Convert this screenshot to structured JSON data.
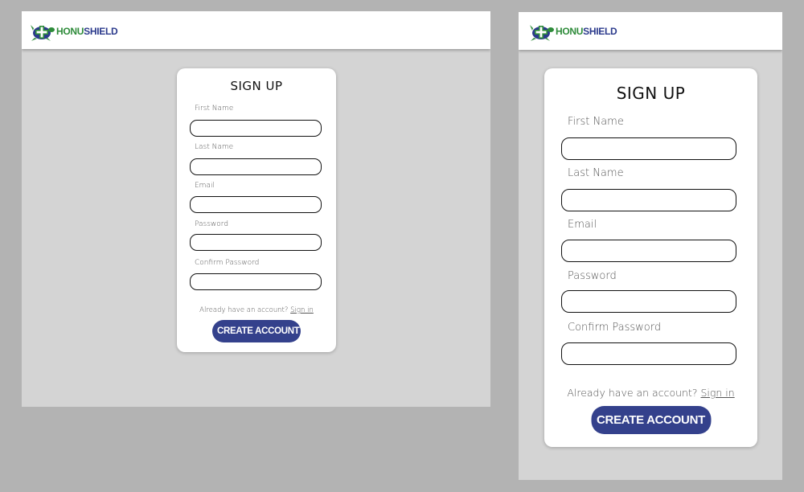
{
  "brand": {
    "part1": "HONU",
    "part2": "SHIELD",
    "green": "#2e8b3a",
    "blue": "#2b3a8c",
    "icon": "turtle-cross-logo-icon"
  },
  "form": {
    "title": "SIGN UP",
    "fields": [
      {
        "label": "First Name",
        "value": ""
      },
      {
        "label": "Last Name",
        "value": ""
      },
      {
        "label": "Email",
        "value": ""
      },
      {
        "label": "Password",
        "value": ""
      },
      {
        "label": "Confirm Password",
        "value": ""
      }
    ],
    "signin_prompt": "Already have an account?",
    "signin_link": "Sign in",
    "submit_label": "CREATE ACCOUNT",
    "button_color": "#34418c"
  }
}
